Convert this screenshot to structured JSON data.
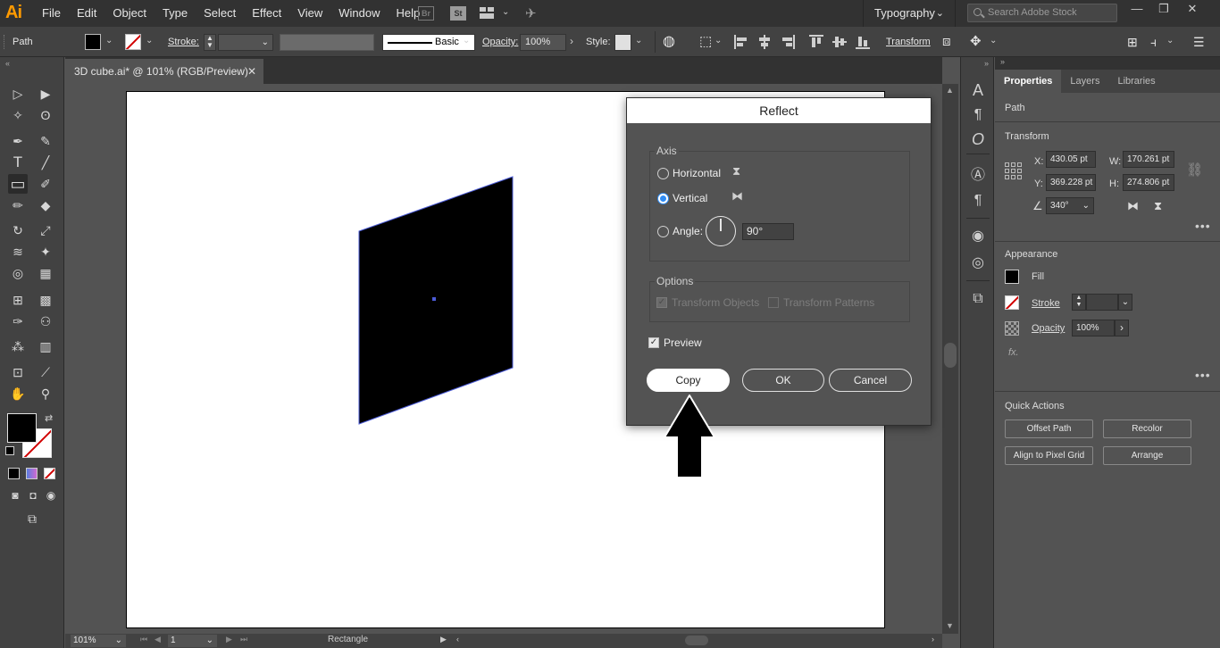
{
  "app": {
    "logo": "Ai",
    "menus": [
      "File",
      "Edit",
      "Object",
      "Type",
      "Select",
      "Effect",
      "View",
      "Window",
      "Help"
    ],
    "bridge_label": "Br",
    "stock_label": "St",
    "workspace": "Typography",
    "search_placeholder": "Search Adobe Stock",
    "window_controls": [
      "—",
      "❐",
      "✕"
    ]
  },
  "control_bar": {
    "selection_type": "Path",
    "stroke_label": "Stroke:",
    "brush_label": "Basic",
    "opacity_label": "Opacity:",
    "opacity_value": "100%",
    "style_label": "Style:",
    "transform_label": "Transform"
  },
  "document": {
    "tab_title": "3D cube.ai* @ 101% (RGB/Preview)",
    "close_glyph": "✕",
    "zoom": "101%",
    "artboard_number": "1",
    "status_info": "Rectangle"
  },
  "toolbar": {
    "tools": [
      {
        "name": "selection-tool",
        "glyph": "▷"
      },
      {
        "name": "direct-selection-tool",
        "glyph": "▶"
      },
      {
        "name": "magic-wand-tool",
        "glyph": "✧"
      },
      {
        "name": "lasso-tool",
        "glyph": "ʘ"
      },
      {
        "name": "pen-tool",
        "glyph": "✒"
      },
      {
        "name": "curvature-tool",
        "glyph": "✎"
      },
      {
        "name": "type-tool",
        "glyph": "T"
      },
      {
        "name": "line-tool",
        "glyph": "╱"
      },
      {
        "name": "rectangle-tool",
        "glyph": "▭"
      },
      {
        "name": "paintbrush-tool",
        "glyph": "✐"
      },
      {
        "name": "shaper-tool",
        "glyph": "✏"
      },
      {
        "name": "eraser-tool",
        "glyph": "◆"
      },
      {
        "name": "rotate-tool",
        "glyph": "↻"
      },
      {
        "name": "scale-tool",
        "glyph": "⤢"
      },
      {
        "name": "warp-tool",
        "glyph": "≋"
      },
      {
        "name": "puppet-warp-tool",
        "glyph": "✦"
      },
      {
        "name": "shape-builder-tool",
        "glyph": "◎"
      },
      {
        "name": "perspective-grid-tool",
        "glyph": "▦"
      },
      {
        "name": "mesh-tool",
        "glyph": "⊞"
      },
      {
        "name": "gradient-tool",
        "glyph": "▩"
      },
      {
        "name": "eyedropper-tool",
        "glyph": "✑"
      },
      {
        "name": "blend-tool",
        "glyph": "⚇"
      },
      {
        "name": "symbol-sprayer-tool",
        "glyph": "⁂"
      },
      {
        "name": "column-graph-tool",
        "glyph": "▥"
      },
      {
        "name": "artboard-tool",
        "glyph": "⊡"
      },
      {
        "name": "slice-tool",
        "glyph": "⟋"
      },
      {
        "name": "hand-tool",
        "glyph": "✋"
      },
      {
        "name": "zoom-tool",
        "glyph": "⚲"
      }
    ]
  },
  "panel": {
    "tabs": [
      "Properties",
      "Layers",
      "Libraries"
    ],
    "object_type": "Path",
    "transform": {
      "title": "Transform",
      "x_label": "X:",
      "x_value": "430.05 pt",
      "y_label": "Y:",
      "y_value": "369.228 pt",
      "w_label": "W:",
      "w_value": "170.261 pt",
      "h_label": "H:",
      "h_value": "274.806 pt",
      "angle_value": "340°"
    },
    "appearance": {
      "title": "Appearance",
      "fill_label": "Fill",
      "stroke_label": "Stroke",
      "opacity_label": "Opacity",
      "opacity_value": "100%",
      "fx_label": "fx."
    },
    "quick_actions": {
      "title": "Quick Actions",
      "buttons": [
        "Offset Path",
        "Recolor",
        "Align to Pixel Grid",
        "Arrange"
      ]
    }
  },
  "dialog": {
    "title": "Reflect",
    "axis_title": "Axis",
    "horizontal_label": "Horizontal",
    "vertical_label": "Vertical",
    "angle_label": "Angle:",
    "angle_value": "90°",
    "options_title": "Options",
    "transform_objects_label": "Transform Objects",
    "transform_patterns_label": "Transform Patterns",
    "preview_label": "Preview",
    "copy_button": "Copy",
    "ok_button": "OK",
    "cancel_button": "Cancel",
    "selected_axis": "Vertical"
  },
  "colors": {
    "accent": "#2f8cf5",
    "logo": "#ff9a00",
    "fill": "#000000",
    "selection": "#4b5bd6",
    "none_slash": "#d10000"
  }
}
